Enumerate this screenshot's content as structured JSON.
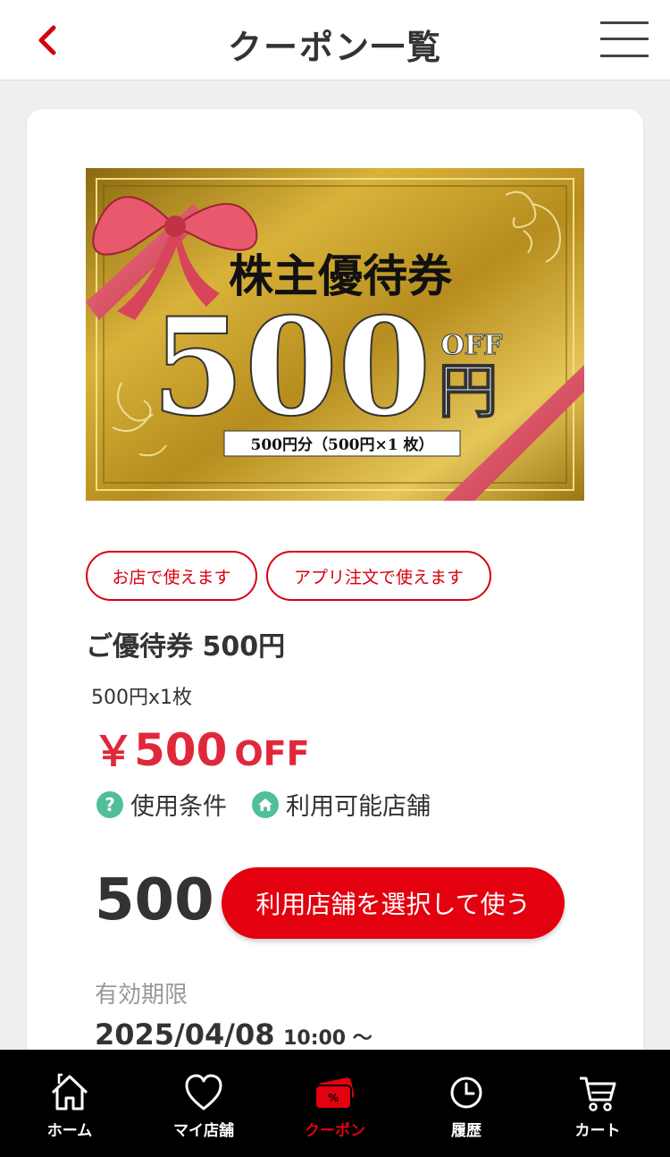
{
  "header": {
    "title": "クーポン一覧"
  },
  "coupon": {
    "image": {
      "heading": "株主優待券",
      "big_amount": "500",
      "off_text": "OFF",
      "yen_text": "円",
      "caption": "500円分（500円×1 枚）"
    },
    "tags": [
      "お店で使えます",
      "アプリ注文で使えます"
    ],
    "title": "ご優待券 500円",
    "subtitle": "500円x1枚",
    "price": {
      "currency": "￥",
      "amount": "500",
      "suffix": "OFF"
    },
    "links": {
      "conditions_label": "使用条件",
      "stores_label": "利用可能店舗"
    },
    "points": "500",
    "use_button_label": "利用店舗を選択して使う",
    "expiry": {
      "label": "有効期限",
      "date": "2025/04/08",
      "time": "10:00 ～"
    }
  },
  "nav": {
    "items": [
      {
        "label": "ホーム",
        "icon": "home-icon"
      },
      {
        "label": "マイ店舗",
        "icon": "heart-icon"
      },
      {
        "label": "クーポン",
        "icon": "coupon-icon",
        "active": true
      },
      {
        "label": "履歴",
        "icon": "clock-icon"
      },
      {
        "label": "カート",
        "icon": "cart-icon"
      }
    ]
  },
  "colors": {
    "accent": "#e3000f",
    "price": "#e0283a",
    "teal_icon": "#4fbf9a",
    "gold": "#c9a227"
  }
}
